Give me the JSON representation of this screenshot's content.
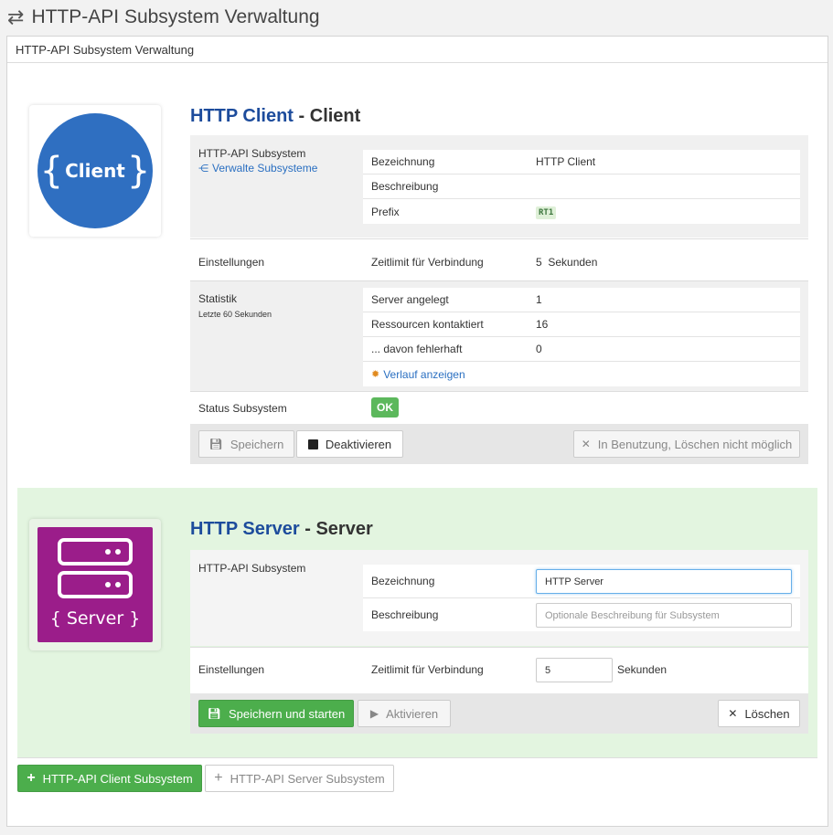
{
  "page": {
    "title": "HTTP-API Subsystem Verwaltung"
  },
  "panel": {
    "heading": "HTTP-API Subsystem Verwaltung"
  },
  "client": {
    "logo_text": "Client",
    "name": "HTTP Client",
    "type_suffix": "- Client",
    "subsystem_label": "HTTP-API Subsystem",
    "manage_link": "Verwalte Subsysteme",
    "rows": [
      {
        "k": "Bezeichnung",
        "v": "HTTP Client"
      },
      {
        "k": "Beschreibung",
        "v": ""
      },
      {
        "k": "Prefix",
        "v": "RT1"
      }
    ],
    "settings_label": "Einstellungen",
    "timeout_label": "Zeitlimit für Verbindung",
    "timeout_value": "5  Sekunden",
    "stats_label": "Statistik",
    "stats_sub": "Letzte 60 Sekunden",
    "stats": [
      {
        "k": "Server angelegt",
        "v": "1"
      },
      {
        "k": "Ressourcen kontaktiert",
        "v": "16"
      },
      {
        "k": "... davon fehlerhaft",
        "v": "0"
      }
    ],
    "history_link": "Verlauf anzeigen",
    "status_label": "Status Subsystem",
    "status_value": "OK",
    "btn_save": "Speichern",
    "btn_deactivate": "Deaktivieren",
    "btn_delete": "In Benutzung, Löschen nicht möglich"
  },
  "server": {
    "logo_text": "{ Server }",
    "name": "HTTP Server",
    "type_suffix": "- Server",
    "subsystem_label": "HTTP-API Subsystem",
    "name_label": "Bezeichnung",
    "name_value": "HTTP Server",
    "desc_label": "Beschreibung",
    "desc_placeholder": "Optionale Beschreibung für Subsystem",
    "settings_label": "Einstellungen",
    "timeout_label": "Zeitlimit für Verbindung",
    "timeout_value": "5",
    "timeout_unit": "Sekunden",
    "btn_save_start": "Speichern und starten",
    "btn_activate": "Aktivieren",
    "btn_delete": "Löschen"
  },
  "footer": {
    "btn_add_client": "HTTP-API Client Subsystem",
    "btn_add_server": "HTTP-API Server Subsystem"
  },
  "colors": {
    "primary": "#1d4c9c",
    "client_logo": "#2f6fc1",
    "server_logo": "#9b1d8a",
    "success": "#5cb85c",
    "server_bg": "#e3f5e0"
  }
}
